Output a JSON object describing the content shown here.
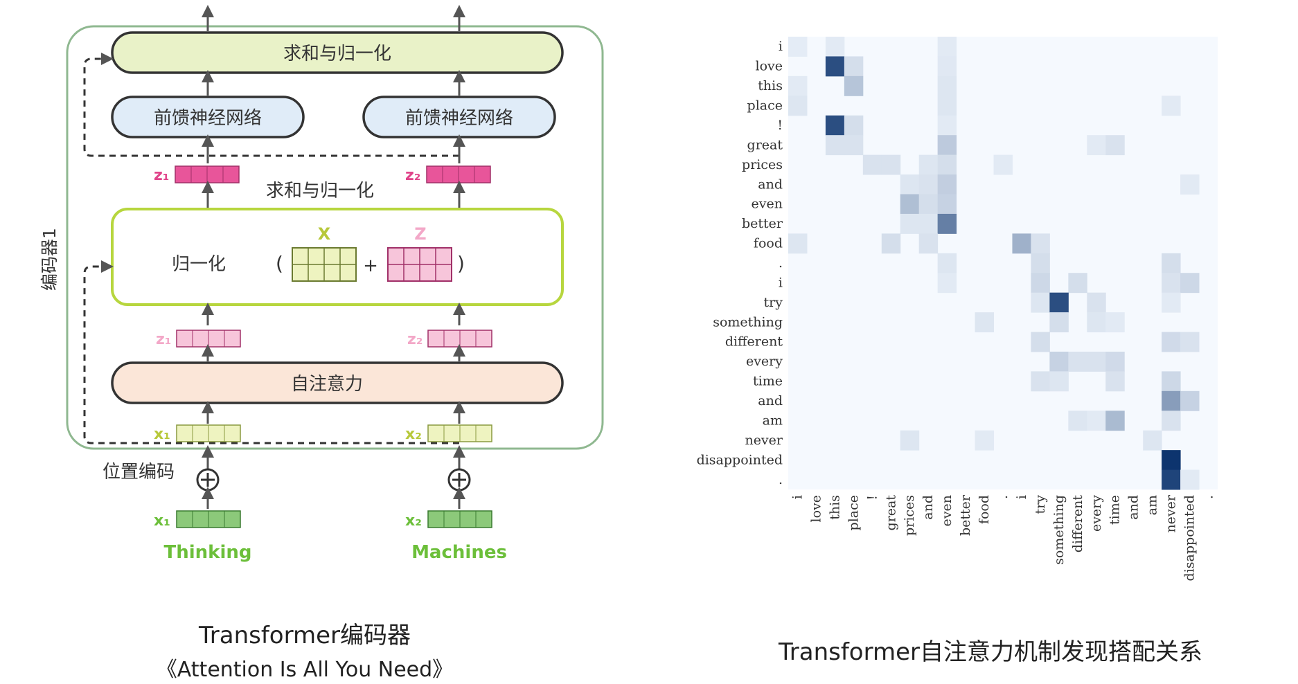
{
  "encoder": {
    "side_label": "编码器1",
    "top_sum_norm": "求和与归一化",
    "ffn_left": "前馈神经网络",
    "ffn_right": "前馈神经网络",
    "mid_sum_norm": "求和与归一化",
    "z1": "z₁",
    "z2": "z₂",
    "norm_label": "归一化",
    "paren_open": "(",
    "paren_close": ")",
    "plus": "+",
    "x_label": "X",
    "z_label": "Z",
    "z1_light": "z₁",
    "z2_light": "z₂",
    "self_attention": "自注意力",
    "x1": "x₁",
    "x2": "x₂",
    "pos_enc": "位置编码",
    "x1_in": "x₁",
    "x2_in": "x₂",
    "word1": "Thinking",
    "word2": "Machines"
  },
  "colors": {
    "green_box": "#b7d63e",
    "green_fill": "#e9f2c8",
    "blue_fill": "#e0ecf8",
    "pink_box": "#e0448a",
    "pink_light": "#f3a8c8",
    "peach_fill": "#fbe6d8",
    "yellow_fill": "#eef3c0",
    "input_green": "#8cc97a",
    "word_green": "#6cbf3a",
    "heat_high": "#08306b"
  },
  "captions": {
    "left_title": "Transformer编码器",
    "left_sub": "《Attention Is All You Need》",
    "right_title": "Transformer自注意力机制发现搭配关系"
  },
  "chart_data": {
    "type": "heatmap",
    "rows": [
      "i",
      "love",
      "this",
      "place",
      "!",
      "great",
      "prices",
      "and",
      "even",
      "better",
      "food",
      ".",
      "i",
      "try",
      "something",
      "different",
      "every",
      "time",
      "and",
      "am",
      "never",
      "disappointed",
      "."
    ],
    "cols": [
      "i",
      "love",
      "this",
      "place",
      "!",
      "great",
      "prices",
      "and",
      "even",
      "better",
      "food",
      ".",
      "i",
      "try",
      "something",
      "different",
      "every",
      "time",
      "and",
      "am",
      "never",
      "disappointed",
      "."
    ],
    "cells": [
      [
        0,
        0,
        0.05
      ],
      [
        0,
        2,
        0.06
      ],
      [
        0,
        8,
        0.06
      ],
      [
        1,
        2,
        0.85
      ],
      [
        1,
        3,
        0.12
      ],
      [
        1,
        8,
        0.07
      ],
      [
        2,
        0,
        0.06
      ],
      [
        2,
        3,
        0.25
      ],
      [
        2,
        8,
        0.08
      ],
      [
        3,
        0,
        0.08
      ],
      [
        3,
        8,
        0.08
      ],
      [
        3,
        20,
        0.06
      ],
      [
        4,
        2,
        0.85
      ],
      [
        4,
        3,
        0.12
      ],
      [
        4,
        8,
        0.06
      ],
      [
        5,
        2,
        0.1
      ],
      [
        5,
        3,
        0.1
      ],
      [
        5,
        8,
        0.22
      ],
      [
        5,
        16,
        0.06
      ],
      [
        5,
        17,
        0.1
      ],
      [
        6,
        4,
        0.1
      ],
      [
        6,
        5,
        0.1
      ],
      [
        6,
        7,
        0.08
      ],
      [
        6,
        8,
        0.12
      ],
      [
        6,
        11,
        0.06
      ],
      [
        7,
        6,
        0.08
      ],
      [
        7,
        7,
        0.1
      ],
      [
        7,
        8,
        0.2
      ],
      [
        7,
        21,
        0.06
      ],
      [
        8,
        6,
        0.28
      ],
      [
        8,
        7,
        0.12
      ],
      [
        8,
        8,
        0.18
      ],
      [
        9,
        6,
        0.08
      ],
      [
        9,
        7,
        0.08
      ],
      [
        9,
        8,
        0.6
      ],
      [
        10,
        0,
        0.08
      ],
      [
        10,
        5,
        0.12
      ],
      [
        10,
        7,
        0.1
      ],
      [
        10,
        12,
        0.35
      ],
      [
        10,
        13,
        0.1
      ],
      [
        11,
        8,
        0.08
      ],
      [
        11,
        13,
        0.12
      ],
      [
        11,
        20,
        0.12
      ],
      [
        12,
        8,
        0.06
      ],
      [
        12,
        13,
        0.15
      ],
      [
        12,
        15,
        0.12
      ],
      [
        12,
        20,
        0.1
      ],
      [
        12,
        21,
        0.15
      ],
      [
        13,
        13,
        0.08
      ],
      [
        13,
        14,
        0.85
      ],
      [
        13,
        16,
        0.1
      ],
      [
        13,
        20,
        0.06
      ],
      [
        14,
        10,
        0.08
      ],
      [
        14,
        14,
        0.12
      ],
      [
        14,
        16,
        0.08
      ],
      [
        14,
        17,
        0.06
      ],
      [
        15,
        13,
        0.12
      ],
      [
        15,
        20,
        0.14
      ],
      [
        15,
        21,
        0.1
      ],
      [
        16,
        14,
        0.18
      ],
      [
        16,
        15,
        0.1
      ],
      [
        16,
        16,
        0.1
      ],
      [
        16,
        17,
        0.14
      ],
      [
        17,
        13,
        0.1
      ],
      [
        17,
        14,
        0.08
      ],
      [
        17,
        17,
        0.1
      ],
      [
        17,
        20,
        0.15
      ],
      [
        18,
        20,
        0.45
      ],
      [
        18,
        21,
        0.18
      ],
      [
        19,
        15,
        0.08
      ],
      [
        19,
        16,
        0.06
      ],
      [
        19,
        17,
        0.3
      ],
      [
        19,
        20,
        0.1
      ],
      [
        20,
        6,
        0.08
      ],
      [
        20,
        10,
        0.06
      ],
      [
        20,
        19,
        0.08
      ],
      [
        21,
        20,
        0.98
      ],
      [
        22,
        20,
        0.9
      ],
      [
        22,
        21,
        0.06
      ]
    ]
  }
}
